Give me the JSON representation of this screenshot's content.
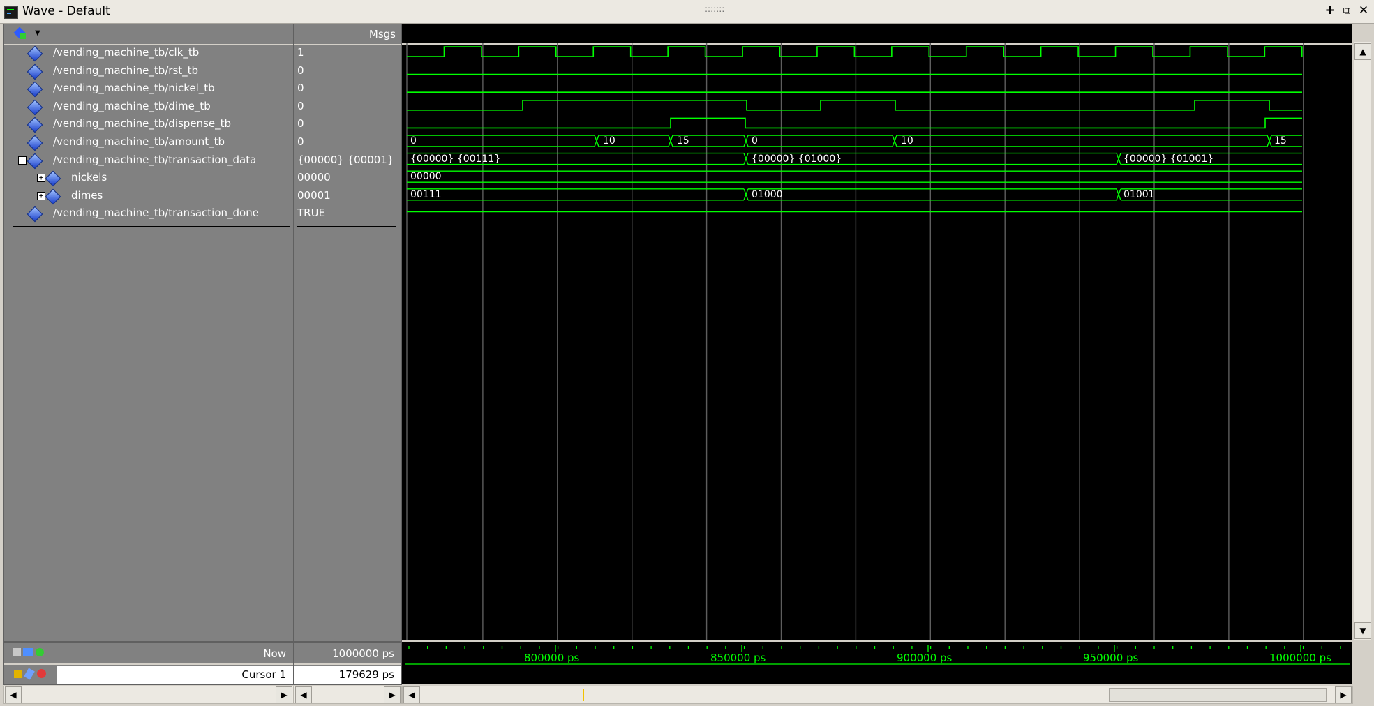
{
  "window": {
    "title": "Wave - Default",
    "grip": ":::::::"
  },
  "header": {
    "msgs_label": "Msgs"
  },
  "signals": [
    {
      "name": "/vending_machine_tb/clk_tb",
      "value": "1"
    },
    {
      "name": "/vending_machine_tb/rst_tb",
      "value": "0"
    },
    {
      "name": "/vending_machine_tb/nickel_tb",
      "value": "0"
    },
    {
      "name": "/vending_machine_tb/dime_tb",
      "value": "0"
    },
    {
      "name": "/vending_machine_tb/dispense_tb",
      "value": "0"
    },
    {
      "name": "/vending_machine_tb/amount_tb",
      "value": "0"
    },
    {
      "name": "/vending_machine_tb/transaction_data",
      "value": "{00000} {00001}"
    },
    {
      "name": "nickels",
      "value": "00000"
    },
    {
      "name": "dimes",
      "value": "00001"
    },
    {
      "name": "/vending_machine_tb/transaction_done",
      "value": "TRUE"
    }
  ],
  "wave_labels": {
    "amount": [
      "0",
      "10",
      "15",
      "0",
      "10",
      "15"
    ],
    "transaction": [
      "{00000} {00111}",
      "{00000} {01000}",
      "{00000} {01001}"
    ],
    "nickels": [
      "00000"
    ],
    "dimes": [
      "00111",
      "01000",
      "01001"
    ]
  },
  "footer": {
    "now_label": "Now",
    "now_value": "1000000 ps",
    "cursor_label": "Cursor 1",
    "cursor_value": "179629 ps"
  },
  "timeline": {
    "labels": [
      "800000 ps",
      "850000 ps",
      "900000 ps",
      "950000 ps",
      "1000000 ps"
    ]
  },
  "colors": {
    "wave": "#00ff00",
    "grid": "#6a6a6a",
    "panel": "#818181",
    "background": "#000000"
  }
}
